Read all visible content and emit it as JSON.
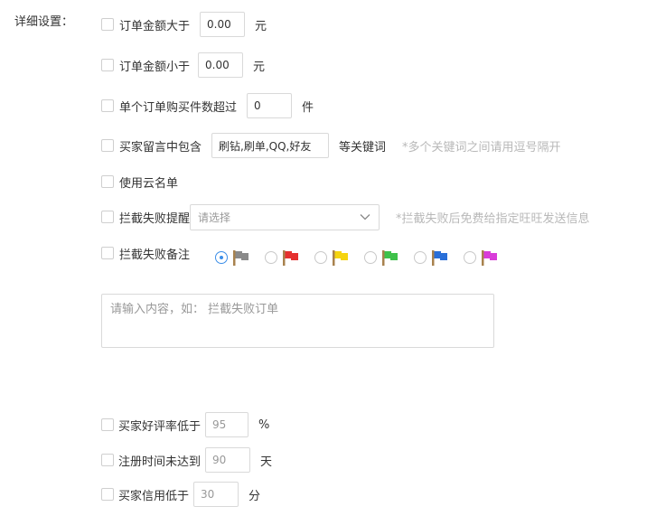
{
  "section": {
    "label": "详细设置："
  },
  "rules": {
    "amount_gt": {
      "label": "订单金额大于",
      "value": "0.00",
      "unit": "元"
    },
    "amount_lt": {
      "label": "订单金额小于",
      "value": "0.00",
      "unit": "元"
    },
    "qty_gt": {
      "label": "单个订单购买件数超过",
      "value": "0",
      "unit": "件"
    },
    "note_contains": {
      "label": "买家留言中包含",
      "value": "刷钻,刷单,QQ,好友",
      "unit": "等关键词",
      "hint": "*多个关键词之间请用逗号隔开"
    },
    "cloud_list": {
      "label": "使用云名单"
    },
    "fail_remind": {
      "label": "拦截失败提醒",
      "placeholder": "请选择",
      "hint": "*拦截失败后免费给指定旺旺发送信息"
    },
    "fail_memo": {
      "label": "拦截失败备注",
      "selected_flag": "gray",
      "flags": [
        {
          "color": "gray",
          "hex": "#8a8a8a"
        },
        {
          "color": "red",
          "hex": "#e5312f"
        },
        {
          "color": "yellow",
          "hex": "#f5d40f"
        },
        {
          "color": "green",
          "hex": "#3ec14a"
        },
        {
          "color": "blue",
          "hex": "#2a6fd8"
        },
        {
          "color": "purple",
          "hex": "#d93cd9"
        }
      ],
      "textarea_placeholder": "请输入内容，如：  拦截失败订单"
    },
    "good_rate": {
      "label": "买家好评率低于",
      "value": "95",
      "unit": "%"
    },
    "reg_time": {
      "label": "注册时间未达到",
      "value": "90",
      "unit": "天"
    },
    "credit": {
      "label": "买家信用低于",
      "value": "30",
      "unit": "分"
    }
  }
}
